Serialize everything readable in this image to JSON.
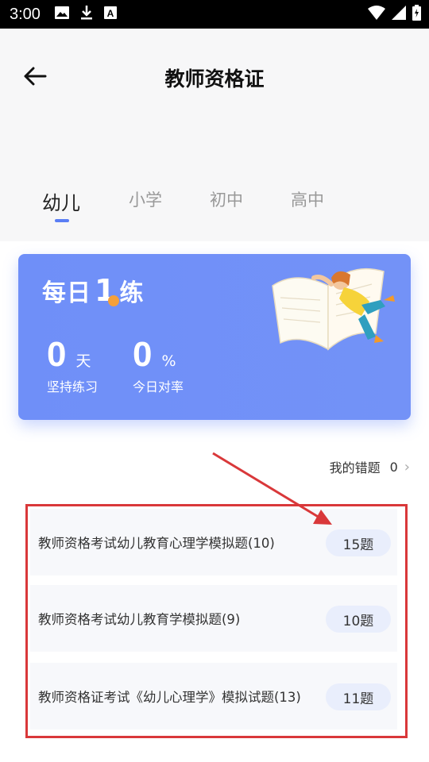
{
  "status_bar": {
    "time": "3:00",
    "icons_left": [
      "image-icon",
      "download-icon",
      "text-a-icon"
    ],
    "icons_right": [
      "wifi-icon",
      "signal-icon",
      "battery-icon"
    ]
  },
  "header": {
    "title": "教师资格证",
    "back_icon": "arrow-left-icon"
  },
  "tabs": [
    {
      "label": "幼儿",
      "active": true
    },
    {
      "label": "小学",
      "active": false
    },
    {
      "label": "初中",
      "active": false
    },
    {
      "label": "高中",
      "active": false
    }
  ],
  "daily_card": {
    "title_pre": "每日",
    "title_num": "1",
    "title_post": "练",
    "streak_value": "0",
    "streak_unit": "天",
    "streak_label": "坚持练习",
    "accuracy_value": "0",
    "accuracy_unit": "%",
    "accuracy_label": "今日对率",
    "accent_color": "#6f8ff8"
  },
  "mistakes": {
    "label": "我的错题",
    "count": "0"
  },
  "list": [
    {
      "title": "教师资格考试幼儿教育心理学模拟题(10)",
      "count": "15题"
    },
    {
      "title": "教师资格考试幼儿教育学模拟题(9)",
      "count": "10题"
    },
    {
      "title": "教师资格证考试《幼儿心理学》模拟试题(13)",
      "count": "11题"
    }
  ]
}
